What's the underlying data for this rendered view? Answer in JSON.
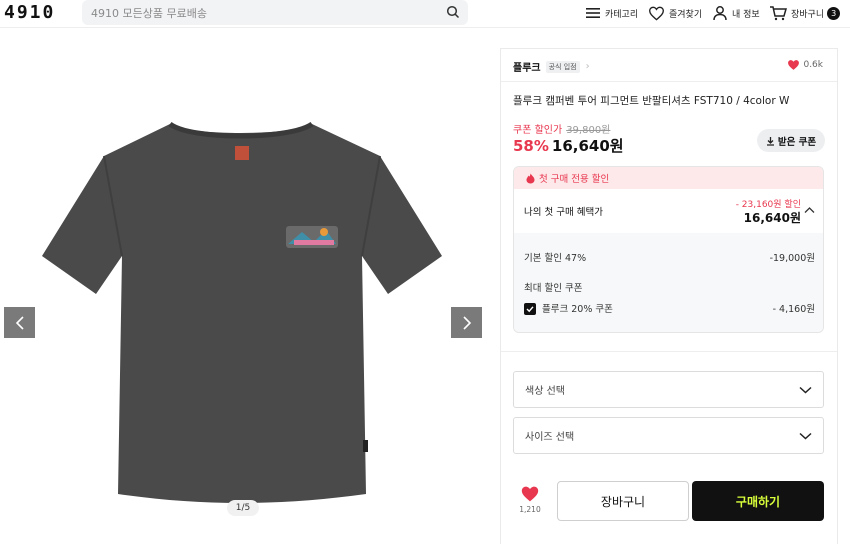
{
  "header": {
    "logo": "4910",
    "search_placeholder": "4910 모든상품 무료배송",
    "nav": [
      {
        "label": "카테고리",
        "icon": "menu-icon"
      },
      {
        "label": "즐겨찾기",
        "icon": "heart-outline-icon"
      },
      {
        "label": "내 정보",
        "icon": "user-icon"
      },
      {
        "label": "장바구니",
        "icon": "cart-icon",
        "badge": "3"
      }
    ]
  },
  "gallery": {
    "counter": "1/5",
    "prev_icon": "chevron-left-icon",
    "next_icon": "chevron-right-icon"
  },
  "product": {
    "brand": "플루크",
    "brand_badge": "공식 입점",
    "likes": "0.6k",
    "title": "플루크 캠퍼벤 투어 피그먼트 반팔티셔츠 FST710 / 4color W",
    "coupon_label": "쿠폰 할인가",
    "original_price": "39,800원",
    "discount_pct": "58%",
    "price": "16,640원",
    "coupon_button": "받은 쿠폰"
  },
  "coupon_box": {
    "header": "첫 구매 전용 할인",
    "benefit_label": "나의 첫 구매 혜택가",
    "benefit_discount": "- 23,160원 할인",
    "benefit_price": "16,640원",
    "base_label": "기본 할인 47%",
    "base_value": "-19,000원",
    "max_coupon_label": "최대 할인 쿠폰",
    "coupon_name": "플루크 20% 쿠폰",
    "coupon_value": "- 4,160원"
  },
  "options": {
    "color_placeholder": "색상 선택",
    "size_placeholder": "사이즈 선택"
  },
  "actions": {
    "like_count": "1,210",
    "cart_label": "장바구니",
    "buy_label": "구매하기"
  },
  "colors": {
    "accent_red": "#e8384f",
    "buy_text": "#d8ff3a",
    "shirt": "#4a4a4a"
  }
}
